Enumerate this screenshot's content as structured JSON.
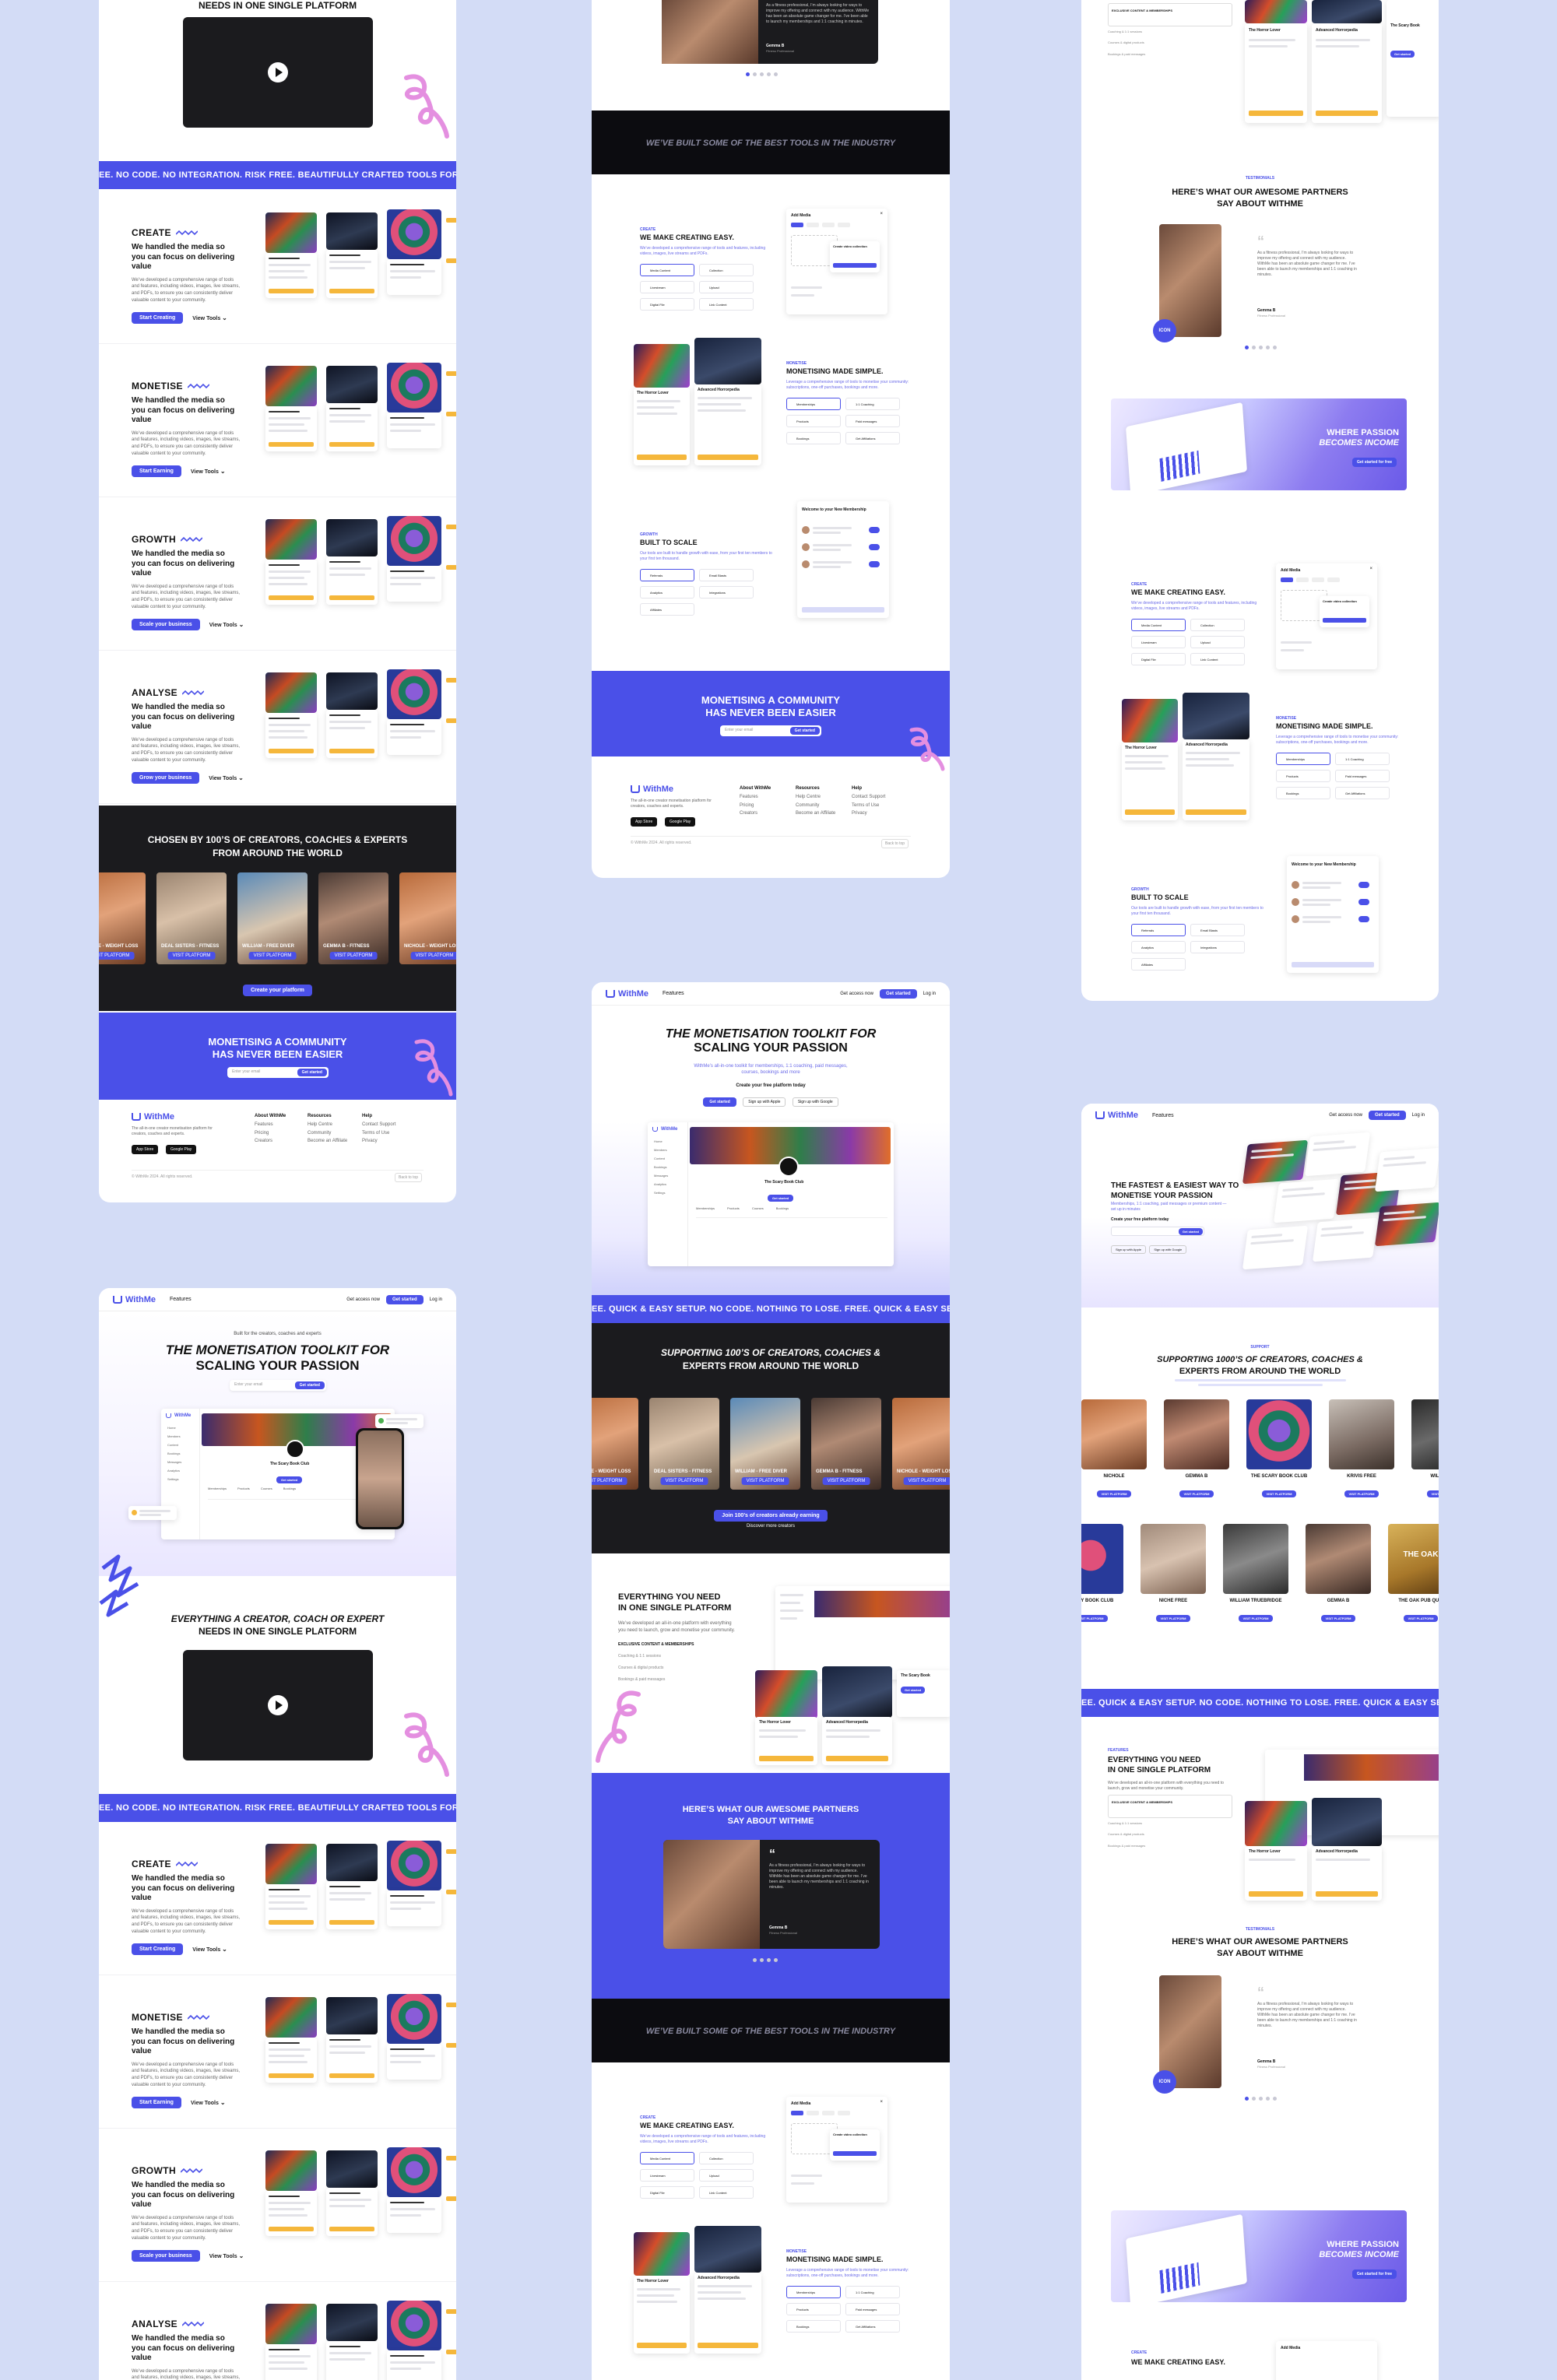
{
  "brand": {
    "name": "WithMe",
    "accent": "#4a50e8",
    "dark": "#1b1b1e",
    "canvas": "#d3dcf6",
    "highlight": "#f5b73b",
    "pink": "#e48fe0"
  },
  "nav": {
    "features": "Features",
    "get_access": "Get access now",
    "get_started": "Get started",
    "login": "Log in"
  },
  "hero": {
    "eyebrow": "Built for the creators, coaches and experts",
    "title_line1": "THE MONETISATION TOOLKIT FOR",
    "title_line2": "SCALING YOUR PASSION",
    "subtitle": "WithMe’s all-in-one toolkit for memberships, 1:1 coaching, paid messages, courses, bookings and more",
    "input_placeholder": "Enter your email",
    "cta": "Get started",
    "claim_label": "Create your free platform today",
    "cta_alt1": "Sign up with Apple",
    "cta_alt2": "Sign up with Google"
  },
  "hero3": {
    "title_line1": "THE FASTEST & EASIEST WAY TO",
    "title_line2": "MONETISE YOUR PASSION",
    "subtitle": "Memberships, 1:1 coaching, paid messages or premium content — set up in minutes",
    "claim_label": "Create your free platform today",
    "cta": "Get started"
  },
  "video": {
    "title_line1": "EVERYTHING A CREATOR, COACH OR EXPERT",
    "title_line2": "NEEDS IN ONE SINGLE PLATFORM",
    "top_title": "NEEDS IN ONE SINGLE PLATFORM"
  },
  "ticker1": "EE. NO CODE. NO INTEGRATION. RISK FREE. BEAUTIFULLY CRAFTED TOOLS FOR CREATORS.  FREE. NO CODE. NO INTEGRATION. RISK FREE.",
  "ticker2": "EE. QUICK & EASY SETUP. NO CODE. NOTHING TO LOSE.  FREE. QUICK & EASY SETUP. NO CODE. NOTHING TO LOSE.  FREE. QUICK & EASY SETUP.",
  "features": [
    {
      "title": "CREATE",
      "sub": "We handled the media so you can focus on delivering value",
      "para": "We’ve developed a comprehensive range of tools and features, including videos, images, live streams, and PDFs, to ensure you can consistently deliver valuable content to your community.",
      "cta": "Start Creating",
      "link": "View Tools"
    },
    {
      "title": "MONETISE",
      "sub": "We handled the media so you can focus on delivering value",
      "para": "We’ve developed a comprehensive range of tools and features, including videos, images, live streams, and PDFs, to ensure you can consistently deliver valuable content to your community.",
      "cta": "Start Earning",
      "link": "View Tools"
    },
    {
      "title": "GROWTH",
      "sub": "We handled the media so you can focus on delivering value",
      "para": "We’ve developed a comprehensive range of tools and features, including videos, images, live streams, and PDFs, to ensure you can consistently deliver valuable content to your community.",
      "cta": "Scale your business",
      "link": "View Tools"
    },
    {
      "title": "ANALYSE",
      "sub": "We handled the media so you can focus on delivering value",
      "para": "We’ve developed a comprehensive range of tools and features, including videos, images, live streams, and PDFs, to ensure you can consistently deliver valuable content to your community.",
      "cta": "Grow your business",
      "link": "View Tools"
    }
  ],
  "chosen": {
    "title_line1": "CHOSEN BY 100’S OF CREATORS, COACHES & EXPERTS",
    "title_line2": "FROM AROUND THE WORLD",
    "cta": "Create your platform",
    "creators": [
      {
        "name": "NICHOLE - WEIGHT LOSS",
        "tag": "VISIT PLATFORM"
      },
      {
        "name": "DEAL SISTERS - FITNESS",
        "tag": "VISIT PLATFORM"
      },
      {
        "name": "WILLIAM - FREE DIVER",
        "tag": "VISIT PLATFORM"
      },
      {
        "name": "GEMMA B - FITNESS",
        "tag": "VISIT PLATFORM"
      },
      {
        "name": "NICHOLE - WEIGHT LOSS",
        "tag": "VISIT PLATFORM"
      }
    ]
  },
  "supporting": {
    "title_line1": "SUPPORTING 100’S OF CREATORS, COACHES &",
    "title_line2": "EXPERTS FROM AROUND THE WORLD",
    "cta": "Join 100’s of creators already earning",
    "link": "Discover more creators"
  },
  "supporting3": {
    "eyebrow": "SUPPORT",
    "title_line1": "SUPPORTING 1000’S OF CREATORS, COACHES &",
    "title_line2": "EXPERTS FROM AROUND THE WORLD",
    "row1": [
      "NICHOLE",
      "GEMMA B",
      "THE SCARY BOOK CLUB",
      "KRIVIS FREE",
      "WILLIAM TR"
    ],
    "row2": [
      "SCARY BOOK CLUB",
      "NICHE FREE",
      "WILLIAM TRUEBRIDGE",
      "GEMMA B",
      "THE OAK PUB QUIZ"
    ],
    "tag": "VISIT PLATFORM",
    "oak_label": "THE OAK"
  },
  "community": {
    "title_line1": "MONETISING A COMMUNITY",
    "title_line2": "HAS NEVER BEEN EASIER",
    "input_placeholder": "Enter your email",
    "cta": "Get started"
  },
  "everything": {
    "title_line1": "EVERYTHING YOU NEED",
    "title_line2": "IN ONE SINGLE PLATFORM",
    "eyebrow": "FEATURES",
    "para": "We’ve developed an all-in-one platform with everything you need to launch, grow and monetise your community.",
    "item1": "EXCLUSIVE CONTENT & MEMBERSHIPS",
    "item2": "Coaching & 1:1 sessions",
    "item3": "Courses & digital products",
    "item4": "Bookings & paid messages"
  },
  "partners": {
    "eyebrow": "TESTIMONIALS",
    "title_line1": "HERE’S WHAT OUR AWESOME PARTNERS",
    "title_line2": "SAY ABOUT WITHME",
    "quote": "As a fitness professional, I’m always looking for ways to improve my offering and connect with my audience. WithMe has been an absolute game changer for me. I’ve been able to launch my memberships and 1:1 coaching in minutes.",
    "author": "Gemma B",
    "role": "Fitness Professional",
    "badge": "ICON"
  },
  "tools_banner": "WE’VE BUILT SOME OF THE BEST TOOLS IN THE INDUSTRY",
  "blocks": {
    "create": {
      "eyebrow": "CREATE",
      "title": "WE MAKE CREATING EASY.",
      "para": "We’ve developed a comprehensive range of tools and features, including videos, images, live streams and PDFs.",
      "items": [
        "Media Content",
        "Collection",
        "Livestream",
        "Upload",
        "Digital File",
        "Link Content"
      ],
      "calendar_title": "Add Media",
      "popup": "Create video collection"
    },
    "monetise": {
      "eyebrow": "MONETISE",
      "title": "MONETISING MADE SIMPLE.",
      "para": "Leverage a comprehensive range of tools to monetise your community: subscriptions, one-off purchases, bookings and more.",
      "items": [
        "Memberships",
        "1:1 Coaching",
        "Products",
        "Paid messages",
        "Bookings",
        "Get Affiliations"
      ],
      "card1": "The Horror Lover",
      "card2": "Advanced Horrorpedia"
    },
    "scale": {
      "eyebrow": "GROWTH",
      "title": "BUILT TO SCALE",
      "para": "Our tools are built to handle growth with ease, from your first ten members to your first ten thousand.",
      "items": [
        "Referrals",
        "Email Blasts",
        "Analytics",
        "Integrations",
        "Affiliates"
      ],
      "card_title": "Welcome to your New Membership"
    }
  },
  "income_banner": {
    "line1": "WHERE PASSION",
    "line2": "BECOMES INCOME",
    "cta": "Get started for free"
  },
  "footer": {
    "tagline": "The all-in-one creator monetisation platform for creators, coaches and experts.",
    "cols": [
      {
        "title": "About WithMe",
        "items": [
          "Features",
          "Pricing",
          "Creators",
          "Blog"
        ]
      },
      {
        "title": "Resources",
        "items": [
          "Help Centre",
          "Community",
          "Become an Affiliate"
        ]
      },
      {
        "title": "Help",
        "items": [
          "Contact Support",
          "Terms of Use",
          "Privacy"
        ]
      }
    ],
    "store1": "App Store",
    "store2": "Google Play",
    "copyright": "© WithMe 2024. All rights reserved.",
    "back_top": "Back to top"
  },
  "app_screen": {
    "profile_name": "The Scary Book Club",
    "sidebar": [
      "Home",
      "Members",
      "Content",
      "Bookings",
      "Messages",
      "Analytics",
      "Settings"
    ],
    "tabs": [
      "Memberships",
      "Products",
      "Courses",
      "Bookings"
    ],
    "tile_label": "The Scary Book"
  }
}
